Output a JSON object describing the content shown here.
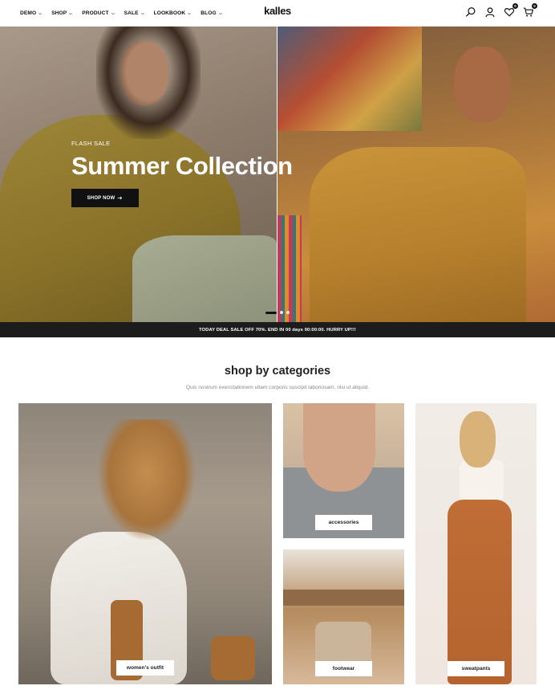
{
  "header": {
    "logo": "kalles",
    "nav": [
      {
        "label": "DEMO"
      },
      {
        "label": "SHOP"
      },
      {
        "label": "PRODUCT"
      },
      {
        "label": "SALE"
      },
      {
        "label": "LOOKBOOK"
      },
      {
        "label": "BLOG"
      }
    ],
    "wishlist_count": "0",
    "cart_count": "0",
    "icons": [
      "search-icon",
      "user-icon",
      "heart-icon",
      "cart-icon"
    ]
  },
  "hero": {
    "subtitle": "FLASH SALE",
    "title": "Summer Collection",
    "button_label": "SHOP NOW",
    "slides_count": 3,
    "active_slide": 1
  },
  "announcement": "TODAY DEAL SALE OFF 70%. END IN 00 days 00:00:00. HURRY UP!!!",
  "categories": {
    "title": "shop by categories",
    "subtitle": "Quis nostrum exercitationem ullam corporis suscipit laboriosam, nisi ut aliquid.",
    "items": [
      {
        "label": "women's outfit"
      },
      {
        "label": "accessories"
      },
      {
        "label": "footwear"
      },
      {
        "label": "sweatpants"
      }
    ]
  },
  "colors": {
    "accent": "#111111",
    "announcement_bg": "#1c1c1c"
  }
}
